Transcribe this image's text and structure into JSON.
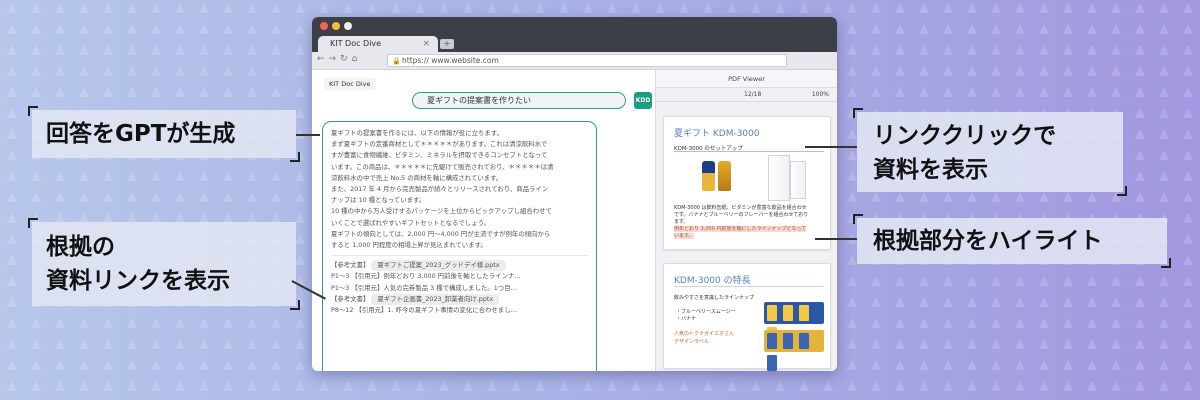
{
  "browser": {
    "tab_title": "KIT Doc Dive",
    "tab_close": "×",
    "new_tab": "+",
    "url": "https:// www.website.com"
  },
  "chat": {
    "brand": "KIT Doc Dive",
    "query": "夏ギフトの提案書を作りたい",
    "avatar": "KDD",
    "answer_lines": [
      "夏ギフトの提案書を作るには、以下の情報が役に立ちます。",
      "まず夏ギフトの定番商材として＊＊＊＊＊があります。これは清涼飲料水で",
      "すが豊富に食物繊維、ビタミン、ミネラルを摂取できるコンセプトとなって",
      "います。この商品は、＊＊＊＊＊に先駆けて販売されており、＊＊＊＊＊は清",
      "涼飲料水の中で売上 No.5 の商材を軸に構成されています。",
      "また、2017 年 4 月から完売製品が続々とリリースされており、商品ライン",
      "ナップは 10 種となっています。",
      "10 種の中から万人受けするパッケージを上位からピックアップし組合わせて",
      "いくことで選ばれやすいギフトセットとなるでしょう。",
      "夏ギフトの傾向としては、2,000 円～4,000 円が主流ですが例年の傾向から",
      "すると 1,000 円程度の相場上昇が見込まれています。"
    ],
    "ref1_label": "【参考文書】",
    "ref1_file": "夏ギフトご提案_2023_グッドデイ様.pptx",
    "ref1_lines": [
      "P1～3 【引用元】例年どおり 3,000 円前後を軸としたラインナ…",
      "P1～3 【引用元】人気の完券製品 3 種で構成しました。1つ目…"
    ],
    "ref2_label": "【参考文書】",
    "ref2_file": "夏ギフト企画書_2023_卸業者向け.pptx",
    "ref2_lines": [
      "P8～12 【引用元】1. 昨今の夏ギフト事情の変化に合わせまし…"
    ]
  },
  "pdf": {
    "header": "PDF Viewer",
    "page": "12/18",
    "zoom": "100%",
    "card1": {
      "title": "夏ギフト KDM-3000",
      "subtitle": "KDM-3000 のセットアップ",
      "text_line1": "KDM-3000 は飲料缶紙、ビタミンが豊富な飲品を組合わせ",
      "text_line2": "です。バナナとブルーベリーのフレーバーを組合わせており",
      "text_line3": "ます。",
      "highlight": "例年どおり 3,000 円前後を軸にしたラインナップとなって",
      "highlight2": "います。"
    },
    "card2": {
      "title": "KDM-3000 の特長",
      "subtitle": "飲みやすさを意識したラインナップ",
      "item1": "・ブルーベリースムージー",
      "item2": "・バナナ",
      "orange1": "人気のトクナガイエオさん",
      "orange2": "デザインラベル"
    }
  },
  "callouts": {
    "left_top": "回答をGPTが生成",
    "left_bottom_line1": "根拠の",
    "left_bottom_line2": "資料リンクを表示",
    "right_top_line1": "リンククリックで",
    "right_top_line2": "資料を表示",
    "right_bottom": "根拠部分をハイライト"
  },
  "colors": {
    "accent_teal": "#1e9d86",
    "highlight": "#f8d9cf",
    "title_blue": "#5a7fb8"
  }
}
